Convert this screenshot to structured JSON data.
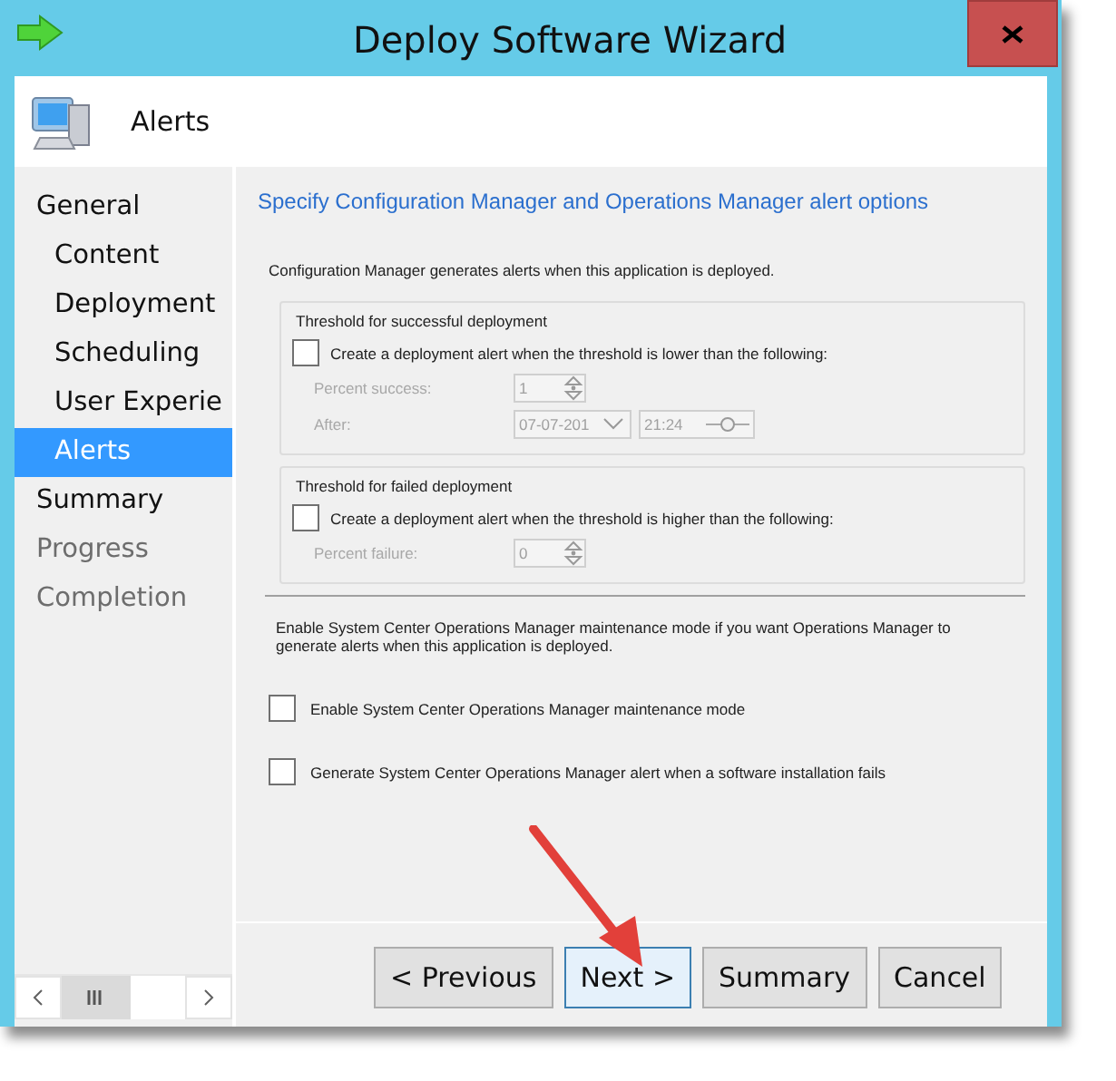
{
  "window": {
    "title": "Deploy Software Wizard"
  },
  "header": {
    "title": "Alerts"
  },
  "sidebar": {
    "items": [
      {
        "label": "General",
        "selected": false,
        "disabled": false,
        "children": [
          {
            "label": "Content",
            "selected": false,
            "disabled": false
          },
          {
            "label": "Deployment",
            "selected": false,
            "disabled": false
          },
          {
            "label": "Scheduling",
            "selected": false,
            "disabled": false
          },
          {
            "label": "User Experie",
            "selected": false,
            "disabled": false
          },
          {
            "label": "Alerts",
            "selected": true,
            "disabled": false
          }
        ]
      },
      {
        "label": "Summary",
        "selected": false,
        "disabled": false
      },
      {
        "label": "Progress",
        "selected": false,
        "disabled": true
      },
      {
        "label": "Completion",
        "selected": false,
        "disabled": true
      }
    ]
  },
  "page": {
    "heading": "Specify Configuration Manager and Operations Manager alert options",
    "intro": "Configuration Manager generates alerts when this application is deployed.",
    "groups": [
      {
        "title": "Threshold for successful deployment",
        "checkbox": {
          "label": "Create a deployment alert when the threshold is lower than the following:",
          "checked": false
        },
        "fields": [
          {
            "kind": "spin",
            "label": "Percent success:",
            "value": "1",
            "disabled": true
          },
          {
            "kind": "datetime",
            "label": "After:",
            "date": "07-07-201",
            "time": "21:24",
            "disabled": true
          }
        ]
      },
      {
        "title": "Threshold for failed deployment",
        "checkbox": {
          "label": "Create a deployment alert when the threshold is higher than the following:",
          "checked": false
        },
        "fields": [
          {
            "kind": "spin",
            "label": "Percent failure:",
            "value": "0",
            "disabled": true
          }
        ]
      }
    ],
    "note": "Enable System Center Operations Manager maintenance mode if you want Operations Manager to generate alerts when this application is deployed.",
    "options": [
      {
        "label": "Enable System Center Operations Manager maintenance mode",
        "checked": false
      },
      {
        "label": "Generate System Center Operations Manager alert when a software installation fails",
        "checked": false
      }
    ]
  },
  "buttons": [
    {
      "label": "< Previous",
      "focused": false
    },
    {
      "label": "Next >",
      "focused": true
    },
    {
      "label": "Summary",
      "focused": false
    },
    {
      "label": "Cancel",
      "focused": false
    }
  ]
}
